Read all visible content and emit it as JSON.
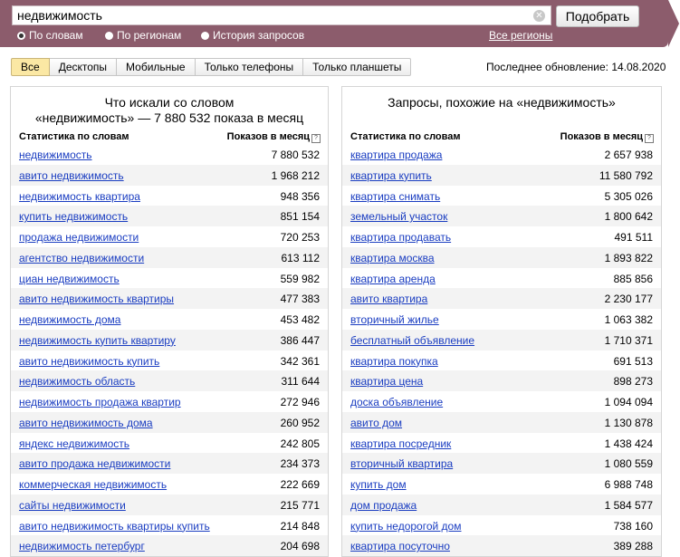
{
  "search": {
    "query": "недвижимость",
    "clear_icon": "clear-icon",
    "submit_label": "Подобрать"
  },
  "modes": [
    {
      "label": "По словам",
      "selected": true
    },
    {
      "label": "По регионам",
      "selected": false
    },
    {
      "label": "История запросов",
      "selected": false
    }
  ],
  "regions_link": "Все регионы",
  "device_tabs": [
    "Все",
    "Десктопы",
    "Мобильные",
    "Только телефоны",
    "Только планшеты"
  ],
  "active_tab": "Все",
  "last_update": "Последнее обновление: 14.08.2020",
  "left": {
    "title_line1": "Что искали со словом",
    "title_line2": "«недвижимость» — 7 880 532 показа в месяц",
    "col_phrase": "Статистика по словам",
    "col_count": "Показов в месяц",
    "rows": [
      [
        "недвижимость",
        "7 880 532"
      ],
      [
        "авито недвижимость",
        "1 968 212"
      ],
      [
        "недвижимость квартира",
        "948 356"
      ],
      [
        "купить недвижимость",
        "851 154"
      ],
      [
        "продажа недвижимости",
        "720 253"
      ],
      [
        "агентство недвижимости",
        "613 112"
      ],
      [
        "циан недвижимость",
        "559 982"
      ],
      [
        "авито недвижимость квартиры",
        "477 383"
      ],
      [
        "недвижимость дома",
        "453 482"
      ],
      [
        "недвижимость купить квартиру",
        "386 447"
      ],
      [
        "авито недвижимость купить",
        "342 361"
      ],
      [
        "недвижимость область",
        "311 644"
      ],
      [
        "недвижимость продажа квартир",
        "272 946"
      ],
      [
        "авито недвижимость дома",
        "260 952"
      ],
      [
        "яндекс недвижимость",
        "242 805"
      ],
      [
        "авито продажа недвижимости",
        "234 373"
      ],
      [
        "коммерческая недвижимость",
        "222 669"
      ],
      [
        "сайты недвижимости",
        "215 771"
      ],
      [
        "авито недвижимость квартиры купить",
        "214 848"
      ],
      [
        "недвижимость петербург",
        "204 698"
      ]
    ]
  },
  "right": {
    "title": "Запросы, похожие на «недвижимость»",
    "col_phrase": "Статистика по словам",
    "col_count": "Показов в месяц",
    "rows": [
      [
        "квартира продажа",
        "2 657 938"
      ],
      [
        "квартира купить",
        "11 580 792"
      ],
      [
        "квартира снимать",
        "5 305 026"
      ],
      [
        "земельный участок",
        "1 800 642"
      ],
      [
        "квартира продавать",
        "491 511"
      ],
      [
        "квартира москва",
        "1 893 822"
      ],
      [
        "квартира аренда",
        "885 856"
      ],
      [
        "авито квартира",
        "2 230 177"
      ],
      [
        "вторичный жилье",
        "1 063 382"
      ],
      [
        "бесплатный объявление",
        "1 710 371"
      ],
      [
        "квартира покупка",
        "691 513"
      ],
      [
        "квартира цена",
        "898 273"
      ],
      [
        "доска объявление",
        "1 094 094"
      ],
      [
        "авито дом",
        "1 130 878"
      ],
      [
        "квартира посредник",
        "1 438 424"
      ],
      [
        "вторичный квартира",
        "1 080 559"
      ],
      [
        "купить дом",
        "6 988 748"
      ],
      [
        "дом продажа",
        "1 584 577"
      ],
      [
        "купить недорогой дом",
        "738 160"
      ],
      [
        "квартира посуточно",
        "389 288"
      ]
    ]
  }
}
